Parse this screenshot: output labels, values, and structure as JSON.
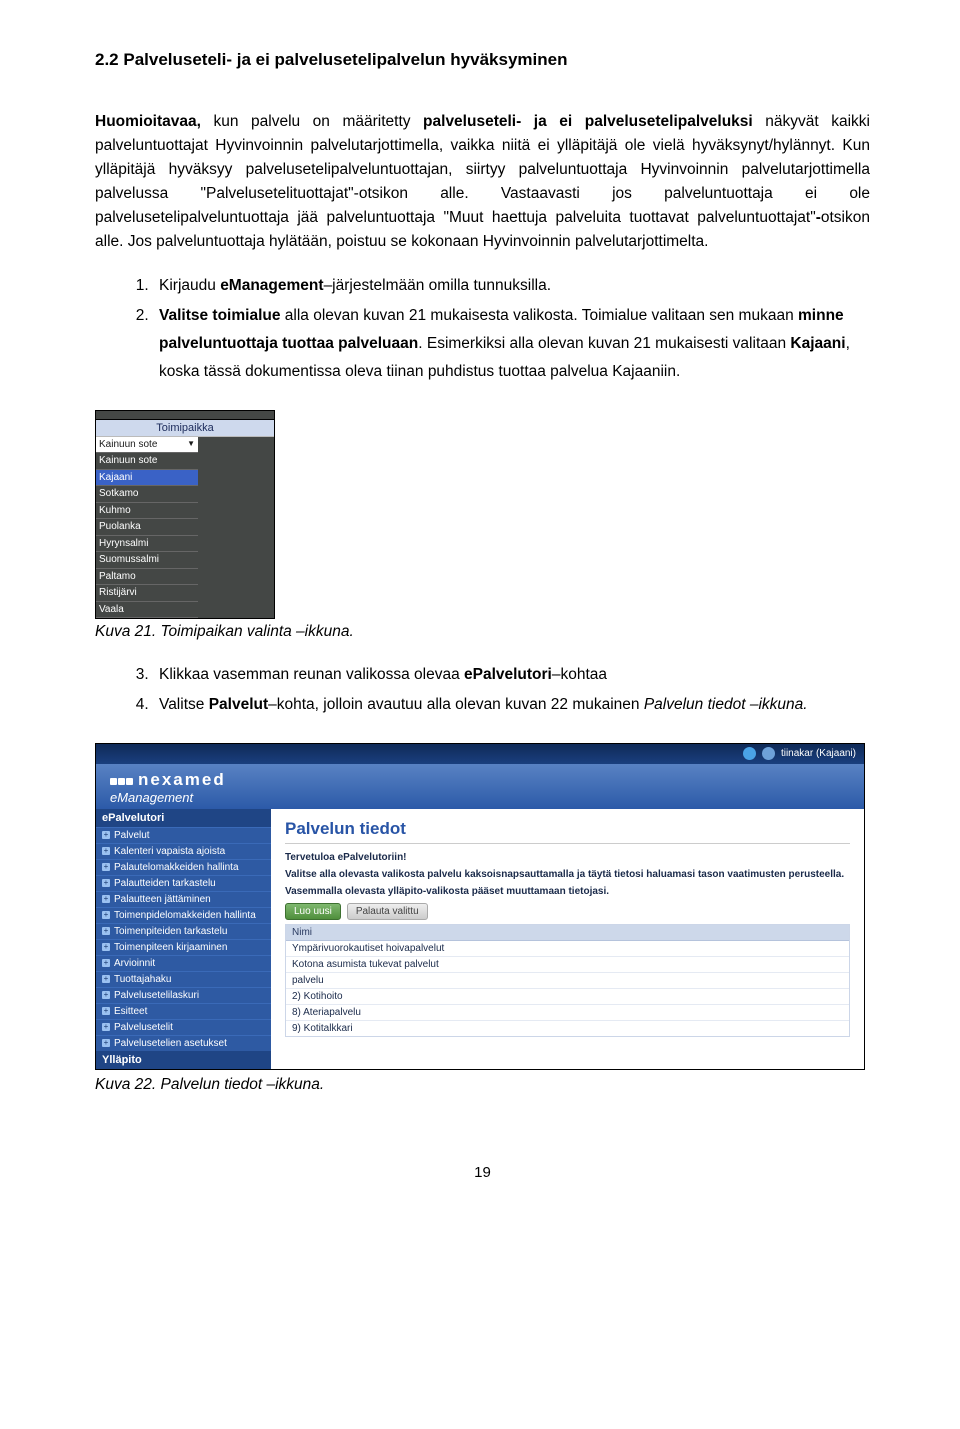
{
  "heading": "2.2 Palveluseteli- ja ei palvelusetelipalvelun hyväksyminen",
  "para1": "Huomioitavaa, kun palvelu on määritetty palveluseteli- ja ei palvelusetelipalveluksi näkyvät kaikki palveluntuottajat Hyvinvoinnin palvelutarjottimella, vaikka niitä ei ylläpitäjä ole vielä hyväksynyt/hylännyt. Kun ylläpitäjä hyväksyy palvelusetelipalveluntuottajan, siirtyy palveluntuottaja Hyvinvoinnin palvelutarjottimella palvelussa \"Palvelusetelituottajat\"-otsikon alle. Vastaavasti jos palveluntuottaja ei ole palvelusetelipalveluntuottaja jää palveluntuottaja \"Muut haettuja palveluita tuottavat palveluntuottajat\"-otsikon alle. Jos palveluntuottaja hylätään, poistuu se kokonaan Hyvinvoinnin palvelutarjottimelta.",
  "steps1": {
    "li1_a": "Kirjaudu ",
    "li1_b": "eManagement",
    "li1_c": "–järjestelmään omilla tunnuksilla.",
    "li2_a": "Valitse toimialue",
    "li2_b": " alla olevan kuvan 21 mukaisesta valikosta. Toimialue valitaan sen mukaan ",
    "li2_c": "minne palveluntuottaja tuottaa palveluaan",
    "li2_d": ". Esimerkiksi alla olevan kuvan 21 mukaisesti valitaan ",
    "li2_e": "Kajaani",
    "li2_f": ", koska tässä dokumentissa oleva tiinan puhdistus tuottaa palvelua Kajaaniin."
  },
  "fig1": {
    "header": "Toimipaikka",
    "items": [
      "Kainuun sote",
      "Kainuun sote",
      "Kajaani",
      "Sotkamo",
      "Kuhmo",
      "Puolanka",
      "Hyrynsalmi",
      "Suomussalmi",
      "Paltamo",
      "Ristijärvi",
      "Vaala"
    ]
  },
  "caption1": "Kuva 21. Toimipaikan valinta –ikkuna.",
  "steps2": {
    "li3_a": "Klikkaa vasemman reunan valikossa olevaa ",
    "li3_b": "ePalvelutori",
    "li3_c": "–kohtaa",
    "li4_a": "Valitse ",
    "li4_b": "Palvelut",
    "li4_c": "–kohta, jolloin avautuu alla olevan kuvan 22 mukainen ",
    "li4_d": "Palvelun tiedot –ikkuna.",
    "li4_e": ""
  },
  "fig2": {
    "topbar_user": "tiinakar (Kajaani)",
    "brand_text": "nexamed",
    "brand_sub": "eManagement",
    "sidebar_hdr1": "ePalvelutori",
    "sidebar_items": [
      "Palvelut",
      "Kalenteri vapaista ajoista",
      "Palautelomakkeiden hallinta",
      "Palautteiden tarkastelu",
      "Palautteen jättäminen",
      "Toimenpidelomakkeiden hallinta",
      "Toimenpiteiden tarkastelu",
      "Toimenpiteen kirjaaminen",
      "Arvioinnit",
      "Tuottajahaku",
      "Palvelusetelilaskuri",
      "Esitteet",
      "Palvelusetelit",
      "Palvelusetelien asetukset"
    ],
    "sidebar_hdr2": "Ylläpito",
    "content_title": "Palvelun tiedot",
    "welcome": "Tervetuloa ePalvelutoriin!",
    "desc1": "Valitse alla olevasta valikosta palvelu kaksoisnapsauttamalla ja täytä tietosi haluamasi tason vaatimusten perusteella.",
    "desc2": "Vasemmalla olevasta ylläpito-valikosta pääset muuttamaan tietojasi.",
    "btn_new": "Luo uusi",
    "btn_reset": "Palauta valittu",
    "th": "Nimi",
    "rows": [
      "Ympärivuorokautiset hoivapalvelut",
      "Kotona asumista tukevat palvelut",
      "palvelu",
      "  2) Kotihoito",
      "  8) Ateriapalvelu",
      "  9) Kotitalkkari"
    ]
  },
  "caption2": "Kuva 22. Palvelun tiedot –ikkuna.",
  "pagenum": "19"
}
